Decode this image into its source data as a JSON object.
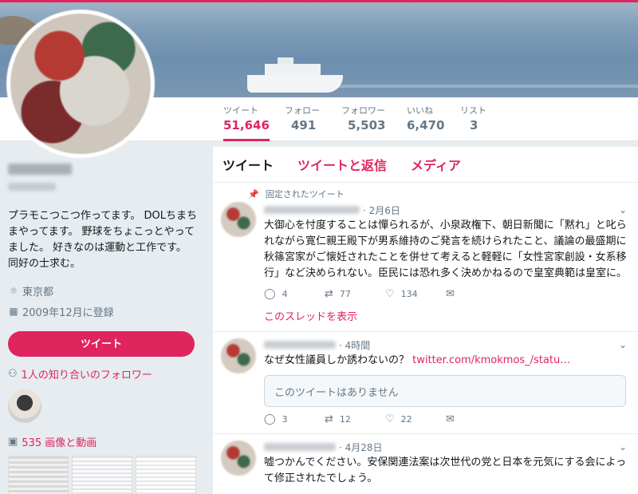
{
  "profile": {
    "bio": "プラモこつこつ作ってます。 DOLちまちまやってます。 野球をちょこっとやってました。 好きなのは運動と工作です。 同好の士求む。",
    "location": "東京都",
    "joined": "2009年12月に登録",
    "tweet_button": "ツイート",
    "mutual_followers": "1人の知り合いのフォロワー",
    "media_link": "535 画像と動画"
  },
  "stats": [
    {
      "label": "ツイート",
      "value": "51,646"
    },
    {
      "label": "フォロー",
      "value": "491"
    },
    {
      "label": "フォロワー",
      "value": "5,503"
    },
    {
      "label": "いいね",
      "value": "6,470"
    },
    {
      "label": "リスト",
      "value": "3"
    }
  ],
  "tabs": [
    "ツイート",
    "ツイートと返信",
    "メディア"
  ],
  "tweets": [
    {
      "pinned_label": "固定されたツイート",
      "date": "· 2月6日",
      "text": "大御心を忖度することは憚られるが、小泉政権下、朝日新聞に「黙れ」と叱られながら寛仁親王殿下が男系維持のご発言を続けられたこと、議論の最盛期に秋篠宮家がご懐妊されたことを併せて考えると軽軽に「女性宮家創設・女系移行」など決められない。臣民には恐れ多く決めかねるので皇室典範は皇室に。",
      "replies": "4",
      "retweets": "77",
      "likes": "134",
      "thread_link": "このスレッドを表示"
    },
    {
      "date": "· 4時間",
      "text": "なぜ女性議員しか誘わないの？ ",
      "link": "twitter.com/kmokmos_/statu…",
      "quote": "このツイートはありません",
      "replies": "3",
      "retweets": "12",
      "likes": "22"
    },
    {
      "date": "· 4月28日",
      "text": "嘘つかんでください。安保関連法案は次世代の党と日本を元気にする会によって修正されたでしょう。"
    }
  ],
  "colors": {
    "accent": "#e0245e",
    "muted": "#657786",
    "background": "#e6ecf0"
  },
  "icons": {
    "location": "map-pin-icon",
    "joined": "calendar-icon",
    "followers": "person-icon",
    "media": "image-icon",
    "pin": "pin-icon",
    "reply": "reply-icon",
    "retweet": "retweet-icon",
    "like": "heart-icon",
    "dm": "envelope-icon",
    "menu": "chevron-down-icon"
  }
}
